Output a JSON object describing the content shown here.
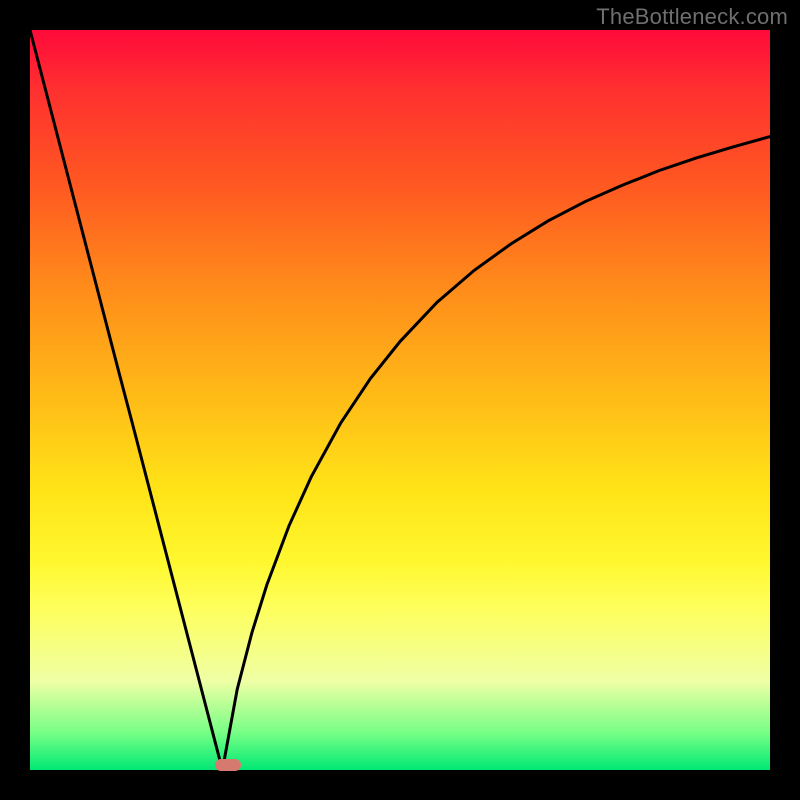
{
  "watermark": {
    "text": "TheBottleneck.com"
  },
  "colors": {
    "background": "#000000",
    "curve": "#000000",
    "marker": "#d67a70"
  },
  "chart_data": {
    "type": "line",
    "title": "",
    "xlabel": "",
    "ylabel": "",
    "xlim": [
      0,
      100
    ],
    "ylim": [
      0,
      100
    ],
    "grid": false,
    "annotations": [
      "TheBottleneck.com"
    ],
    "minimum_x": 26,
    "marker": {
      "x_start": 25,
      "x_end": 28.5,
      "y": 0
    },
    "series": [
      {
        "name": "left-branch",
        "x": [
          0,
          2,
          4,
          6,
          8,
          10,
          12,
          14,
          16,
          18,
          20,
          22,
          24,
          26
        ],
        "y": [
          100,
          92.3,
          84.6,
          76.9,
          69.2,
          61.5,
          53.8,
          46.2,
          38.5,
          30.8,
          23.1,
          15.4,
          7.7,
          0
        ]
      },
      {
        "name": "right-branch",
        "x": [
          26,
          28,
          30,
          32,
          35,
          38,
          42,
          46,
          50,
          55,
          60,
          65,
          70,
          75,
          80,
          85,
          90,
          95,
          100
        ],
        "y": [
          0,
          10.9,
          18.6,
          25.0,
          33.0,
          39.6,
          46.9,
          52.9,
          57.9,
          63.2,
          67.5,
          71.1,
          74.2,
          76.8,
          79.0,
          81.0,
          82.7,
          84.2,
          85.6
        ]
      }
    ]
  }
}
